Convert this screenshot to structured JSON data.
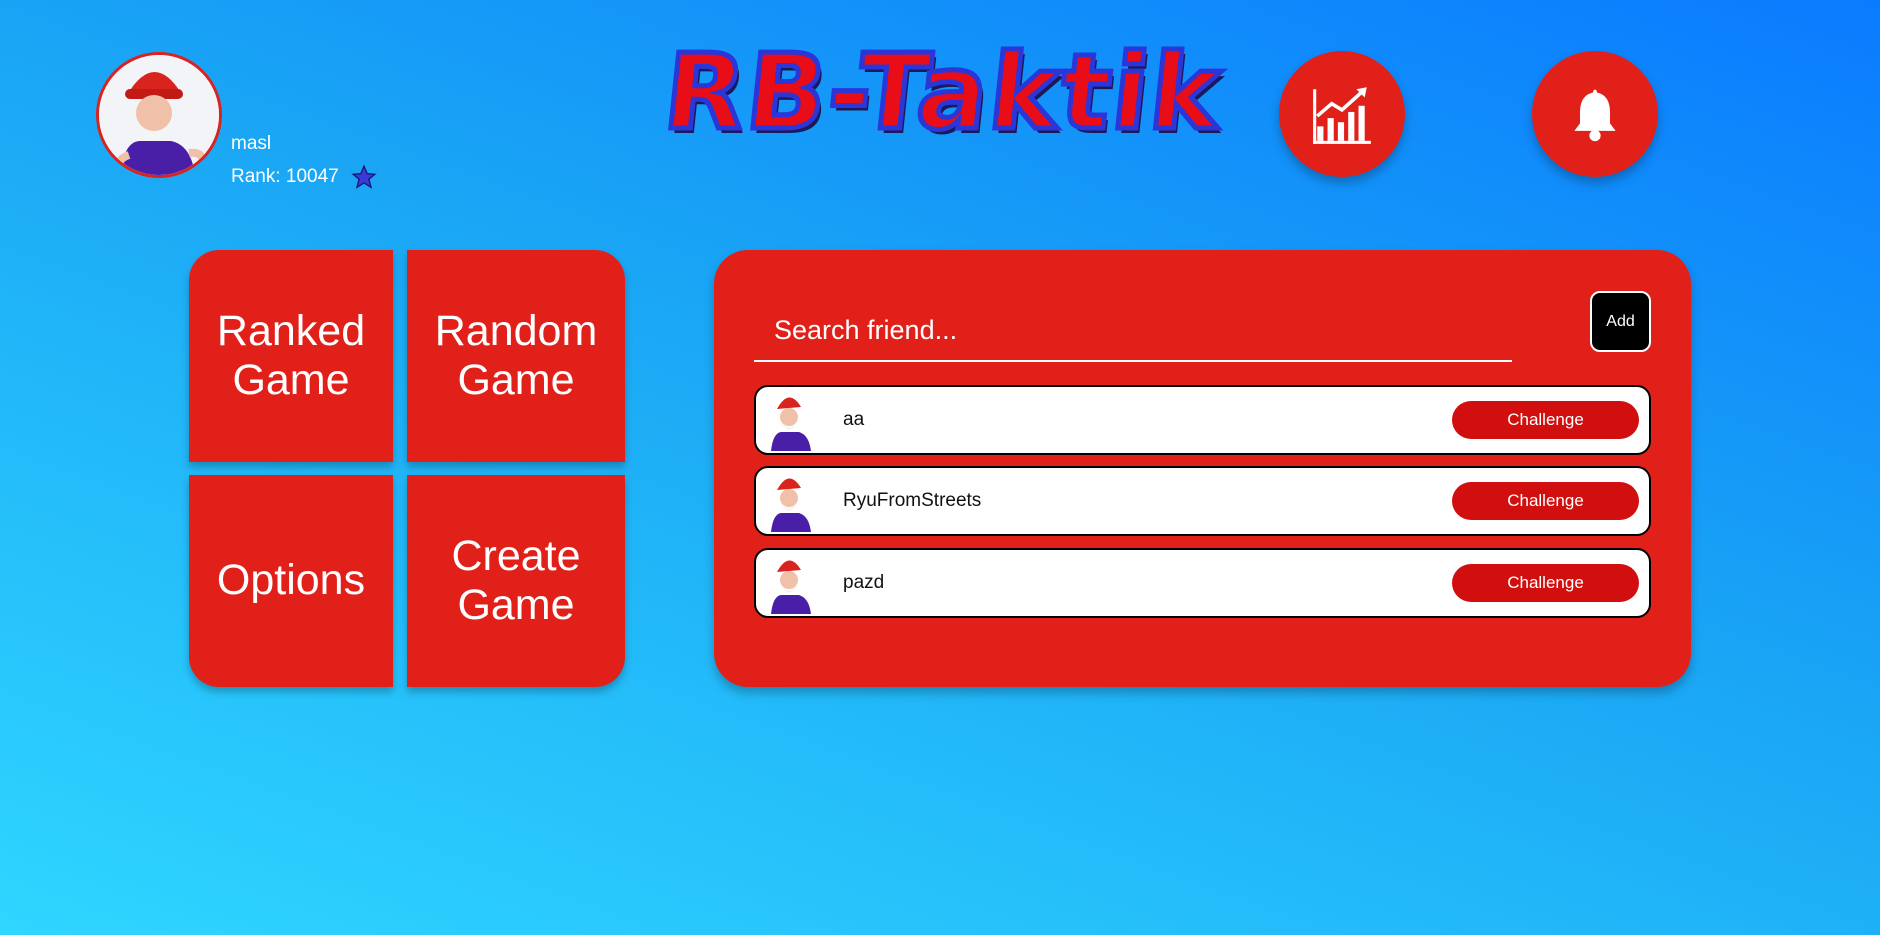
{
  "profile": {
    "avatar_icon": "gnome-avatar-icon",
    "username": "masl",
    "rank_label": "Rank: 10047",
    "rank_icon": "star-icon"
  },
  "header": {
    "logo_text": "RB-Taktik",
    "stats_icon": "bar-chart-trend-icon",
    "notifications_icon": "bell-icon"
  },
  "menu": {
    "ranked": "Ranked Game",
    "random": "Random Game",
    "options": "Options",
    "create": "Create Game"
  },
  "friends": {
    "search_placeholder": "Search friend...",
    "add_label": "Add",
    "list": [
      {
        "name": "aa",
        "action": "Challenge"
      },
      {
        "name": "RyuFromStreets",
        "action": "Challenge"
      },
      {
        "name": "pazd",
        "action": "Challenge"
      }
    ]
  },
  "colors": {
    "accent_red": "#e1201a",
    "challenge_red": "#d20f0f",
    "background_top": "#0a7bff",
    "background_bottom": "#2fd6ff"
  }
}
